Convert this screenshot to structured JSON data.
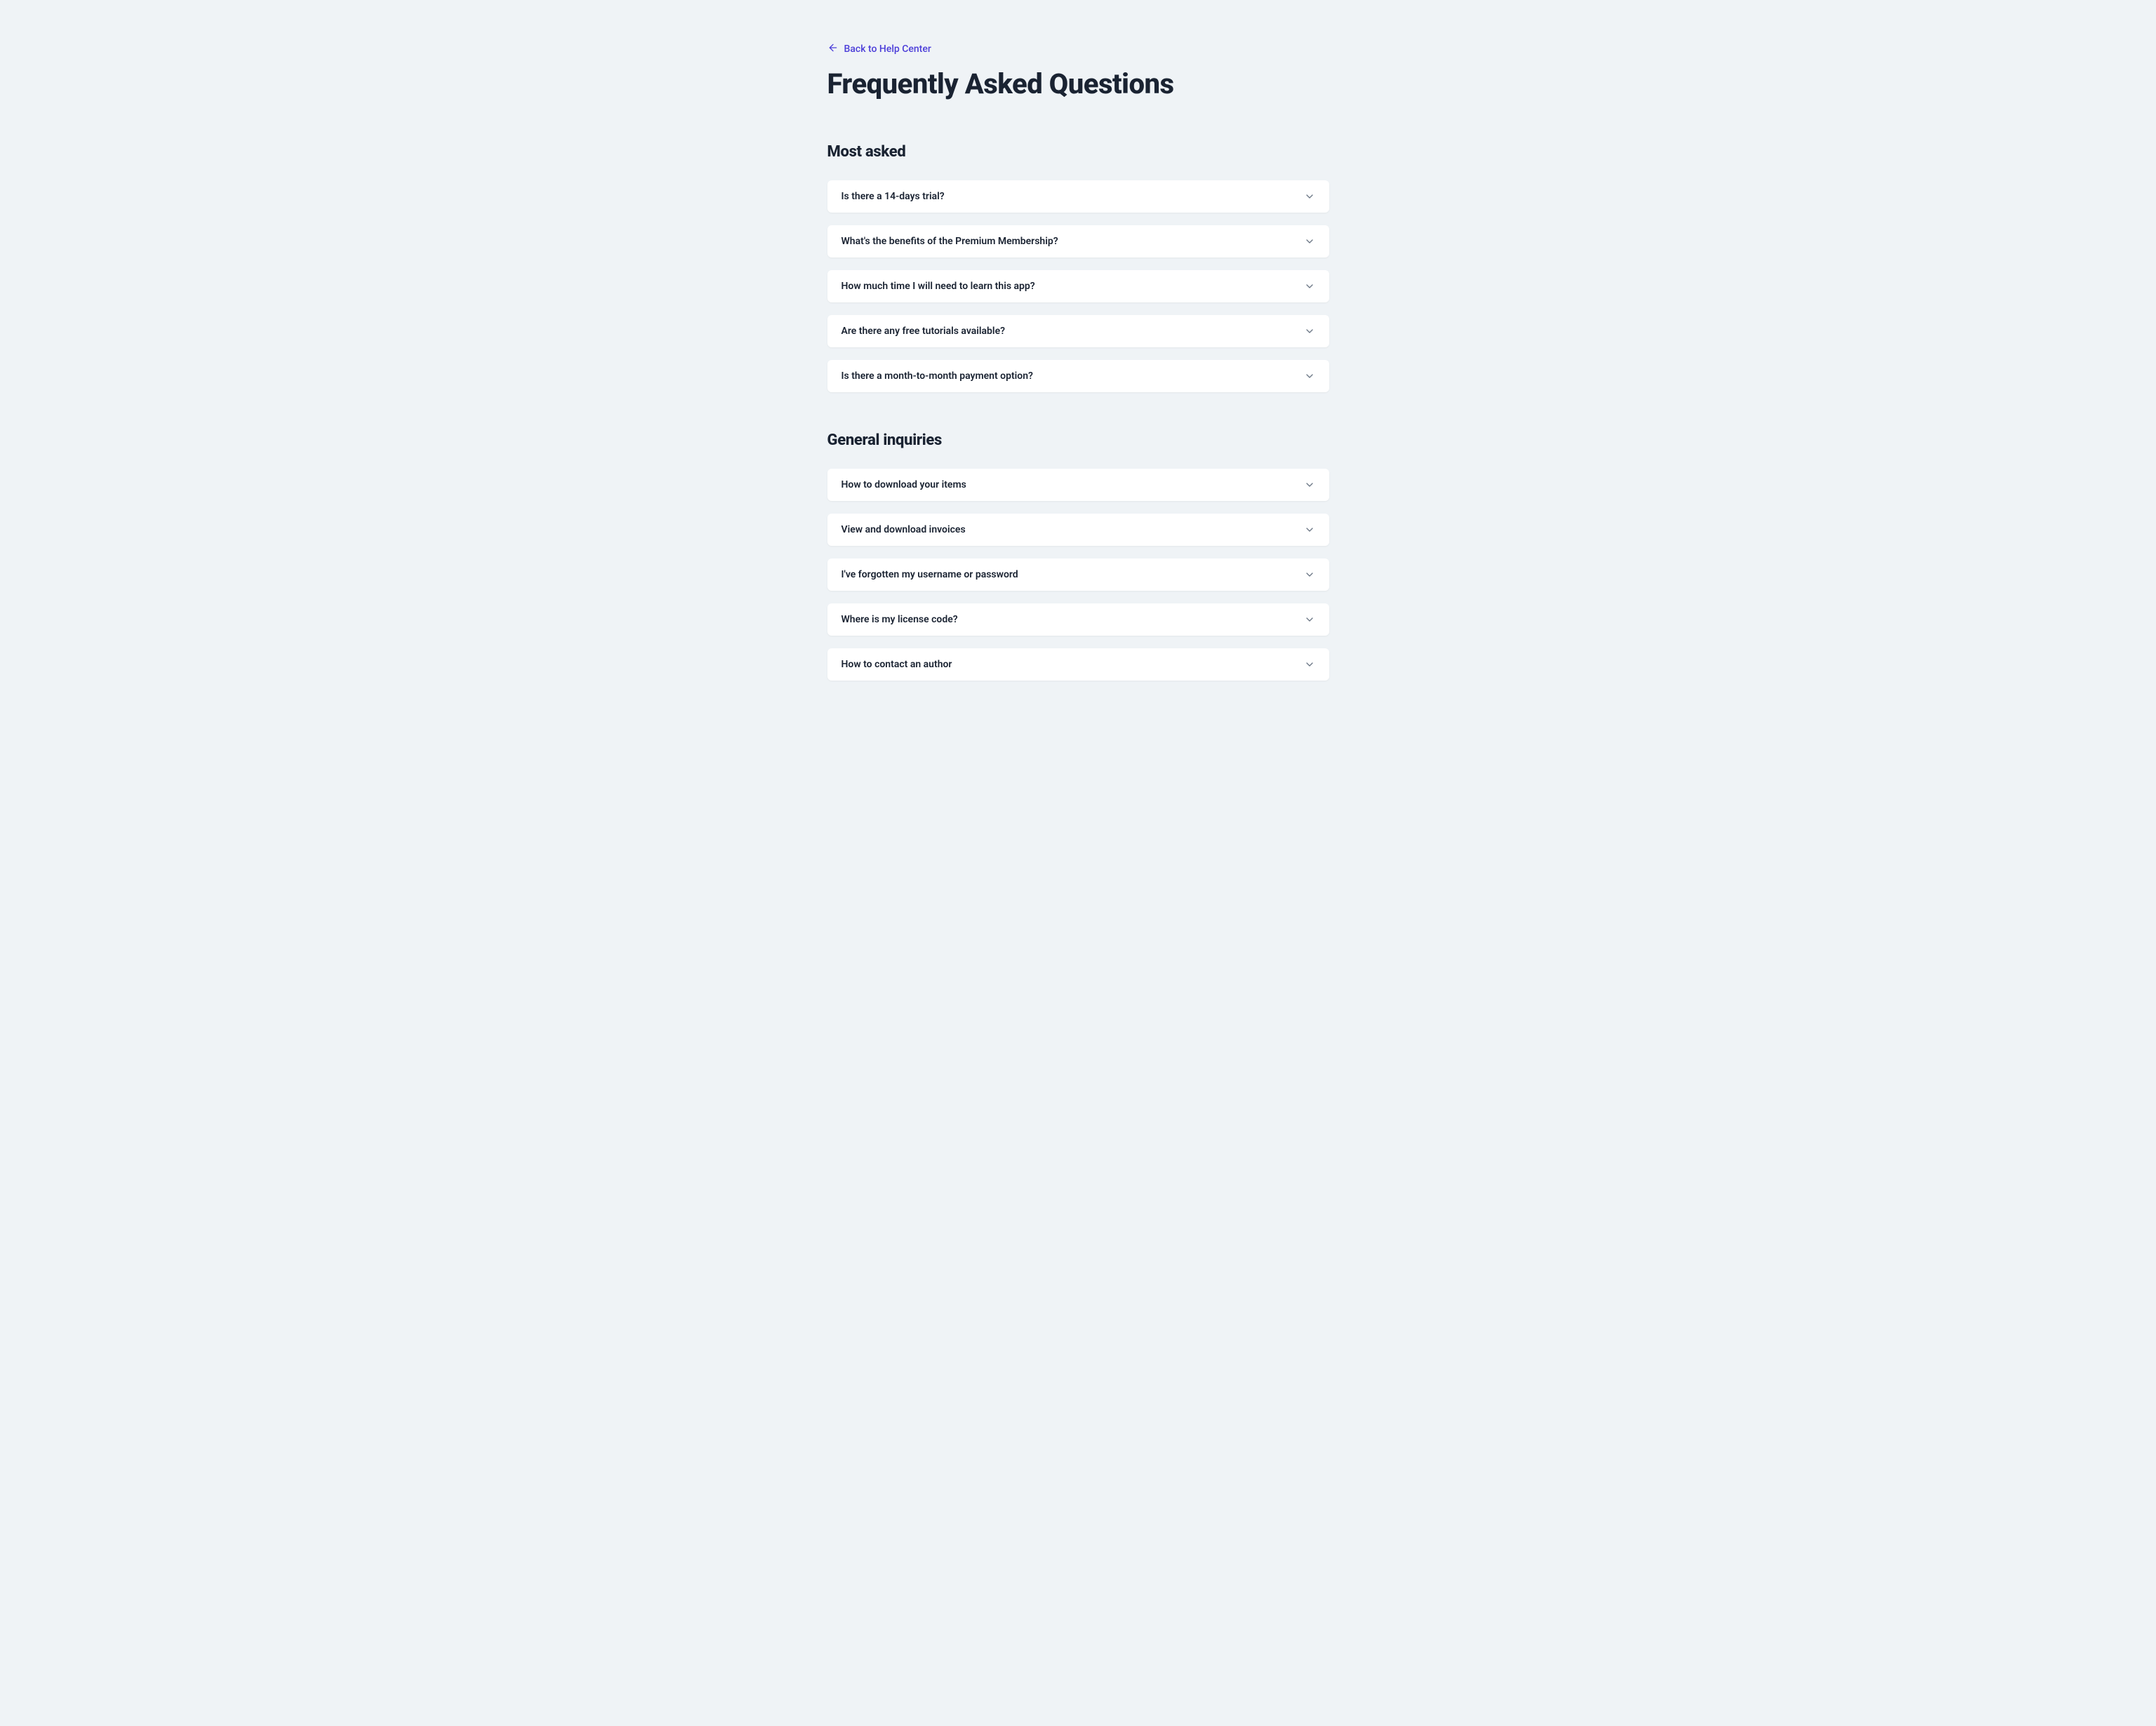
{
  "back_link": {
    "label": "Back to Help Center"
  },
  "page_title": "Frequently Asked Questions",
  "sections": [
    {
      "title": "Most asked",
      "items": [
        {
          "label": "Is there a 14-days trial?"
        },
        {
          "label": "What's the benefits of the Premium Membership?"
        },
        {
          "label": "How much time I will need to learn this app?"
        },
        {
          "label": "Are there any free tutorials available?"
        },
        {
          "label": "Is there a month-to-month payment option?"
        }
      ]
    },
    {
      "title": "General inquiries",
      "items": [
        {
          "label": "How to download your items"
        },
        {
          "label": "View and download invoices"
        },
        {
          "label": "I've forgotten my username or password"
        },
        {
          "label": "Where is my license code?"
        },
        {
          "label": "How to contact an author"
        }
      ]
    }
  ]
}
